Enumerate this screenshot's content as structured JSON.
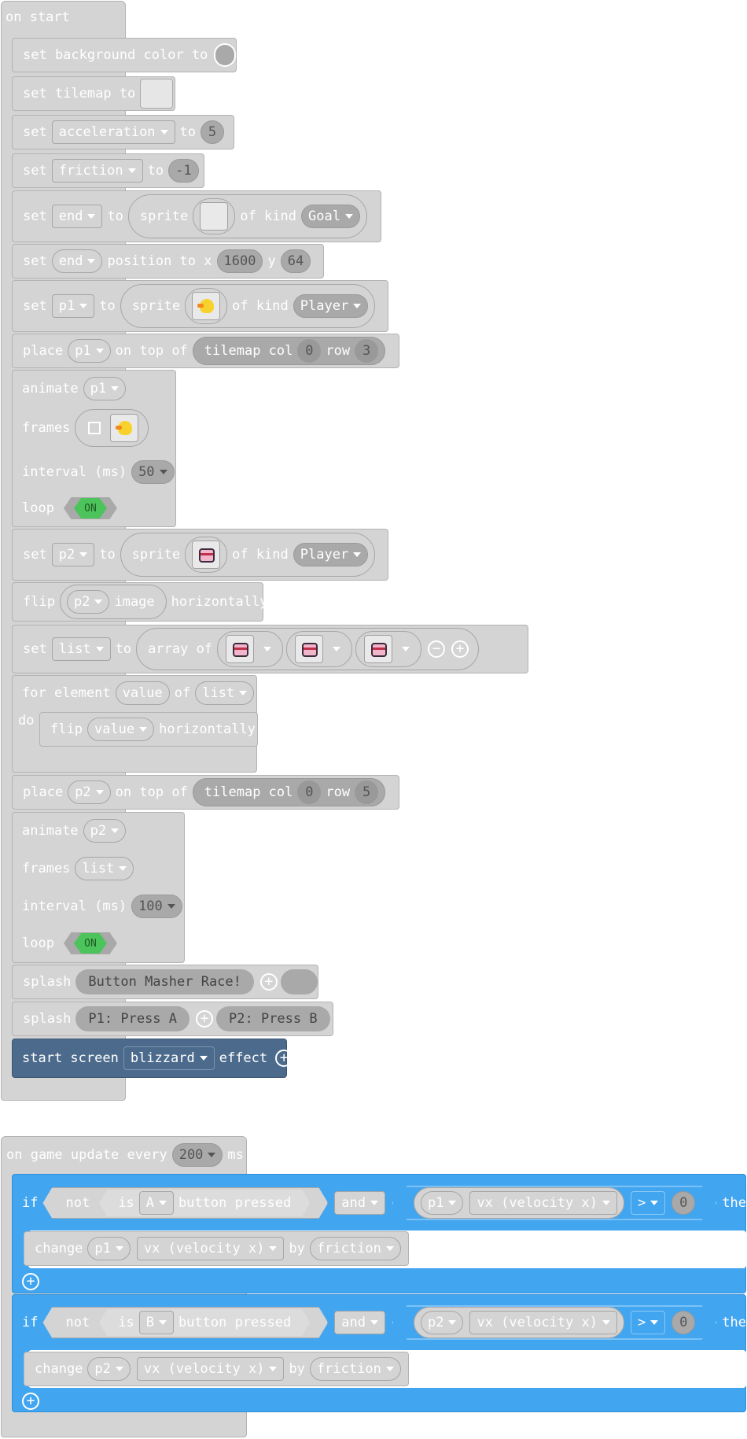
{
  "on_start": {
    "label": "on start",
    "bg_color": {
      "label": "set background color to"
    },
    "tilemap": {
      "label": "set tilemap to"
    },
    "set_acc": {
      "set": "set",
      "var": "acceleration",
      "to": "to",
      "value": "5"
    },
    "set_fric": {
      "set": "set",
      "var": "friction",
      "to": "to",
      "value": "-1"
    },
    "set_end": {
      "set": "set",
      "var": "end",
      "to": "to",
      "sprite": "sprite",
      "of_kind": "of kind",
      "kind": "Goal"
    },
    "set_end_pos": {
      "set": "set",
      "var": "end",
      "position": "position to x",
      "x": "1600",
      "y_label": "y",
      "y": "64"
    },
    "set_p1": {
      "set": "set",
      "var": "p1",
      "to": "to",
      "sprite": "sprite",
      "of_kind": "of kind",
      "kind": "Player"
    },
    "place_p1": {
      "place": "place",
      "var": "p1",
      "on_top": "on top of",
      "tilemap_col": "tilemap col",
      "col": "0",
      "row_label": "row",
      "row": "3"
    },
    "animate_p1": {
      "animate": "animate",
      "var": "p1",
      "frames": "frames",
      "interval": "interval (ms)",
      "interval_value": "50",
      "loop": "loop",
      "loop_state": "ON"
    },
    "set_p2": {
      "set": "set",
      "var": "p2",
      "to": "to",
      "sprite": "sprite",
      "of_kind": "of kind",
      "kind": "Player"
    },
    "flip_p2": {
      "flip": "flip",
      "var": "p2",
      "image": "image",
      "horizontally": "horizontally"
    },
    "set_list": {
      "set": "set",
      "var": "list",
      "to": "to",
      "array_of": "array of"
    },
    "for_each": {
      "for_element": "for element",
      "var": "value",
      "of": "of",
      "list": "list",
      "do": "do",
      "flip": "flip",
      "inner_var": "value",
      "horizontally": "horizontally"
    },
    "place_p2": {
      "place": "place",
      "var": "p2",
      "on_top": "on top of",
      "tilemap_col": "tilemap col",
      "col": "0",
      "row_label": "row",
      "row": "5"
    },
    "animate_p2": {
      "animate": "animate",
      "var": "p2",
      "frames": "frames",
      "frames_value": "list",
      "interval": "interval (ms)",
      "interval_value": "100",
      "loop": "loop",
      "loop_state": "ON"
    },
    "splash1": {
      "label": "splash",
      "text": "Button Masher Race!"
    },
    "splash2": {
      "label": "splash",
      "text1": "P1: Press A",
      "text2": "P2: Press B"
    },
    "start_screen": {
      "label": "start screen",
      "effect_name": "blizzard",
      "effect": "effect"
    }
  },
  "on_update": {
    "label": "on game update every",
    "interval": "200",
    "unit": "ms",
    "if1": {
      "if": "if",
      "not": "not",
      "is": "is",
      "button": "A",
      "pressed": "button pressed",
      "and": "and",
      "sprite": "p1",
      "prop": "vx (velocity x)",
      "op": ">",
      "value": "0",
      "then": "then",
      "change": "change",
      "c_sprite": "p1",
      "c_prop": "vx (velocity x)",
      "by": "by",
      "c_value": "friction"
    },
    "if2": {
      "if": "if",
      "not": "not",
      "is": "is",
      "button": "B",
      "pressed": "button pressed",
      "and": "and",
      "sprite": "p2",
      "prop": "vx (velocity x)",
      "op": ">",
      "value": "0",
      "then": "then",
      "change": "change",
      "c_sprite": "p2",
      "c_prop": "vx (velocity x)",
      "by": "by",
      "c_value": "friction"
    }
  },
  "colors": {
    "block_gray": "#d4d4d4",
    "logic_blue": "#42a5f0",
    "scene_navy": "#4c6b8c",
    "toggle_green": "#4cc45b"
  },
  "icons": [
    "duck-sprite-icon",
    "cat-sprite-icon",
    "add-icon",
    "remove-icon",
    "dropdown-arrow-icon"
  ]
}
